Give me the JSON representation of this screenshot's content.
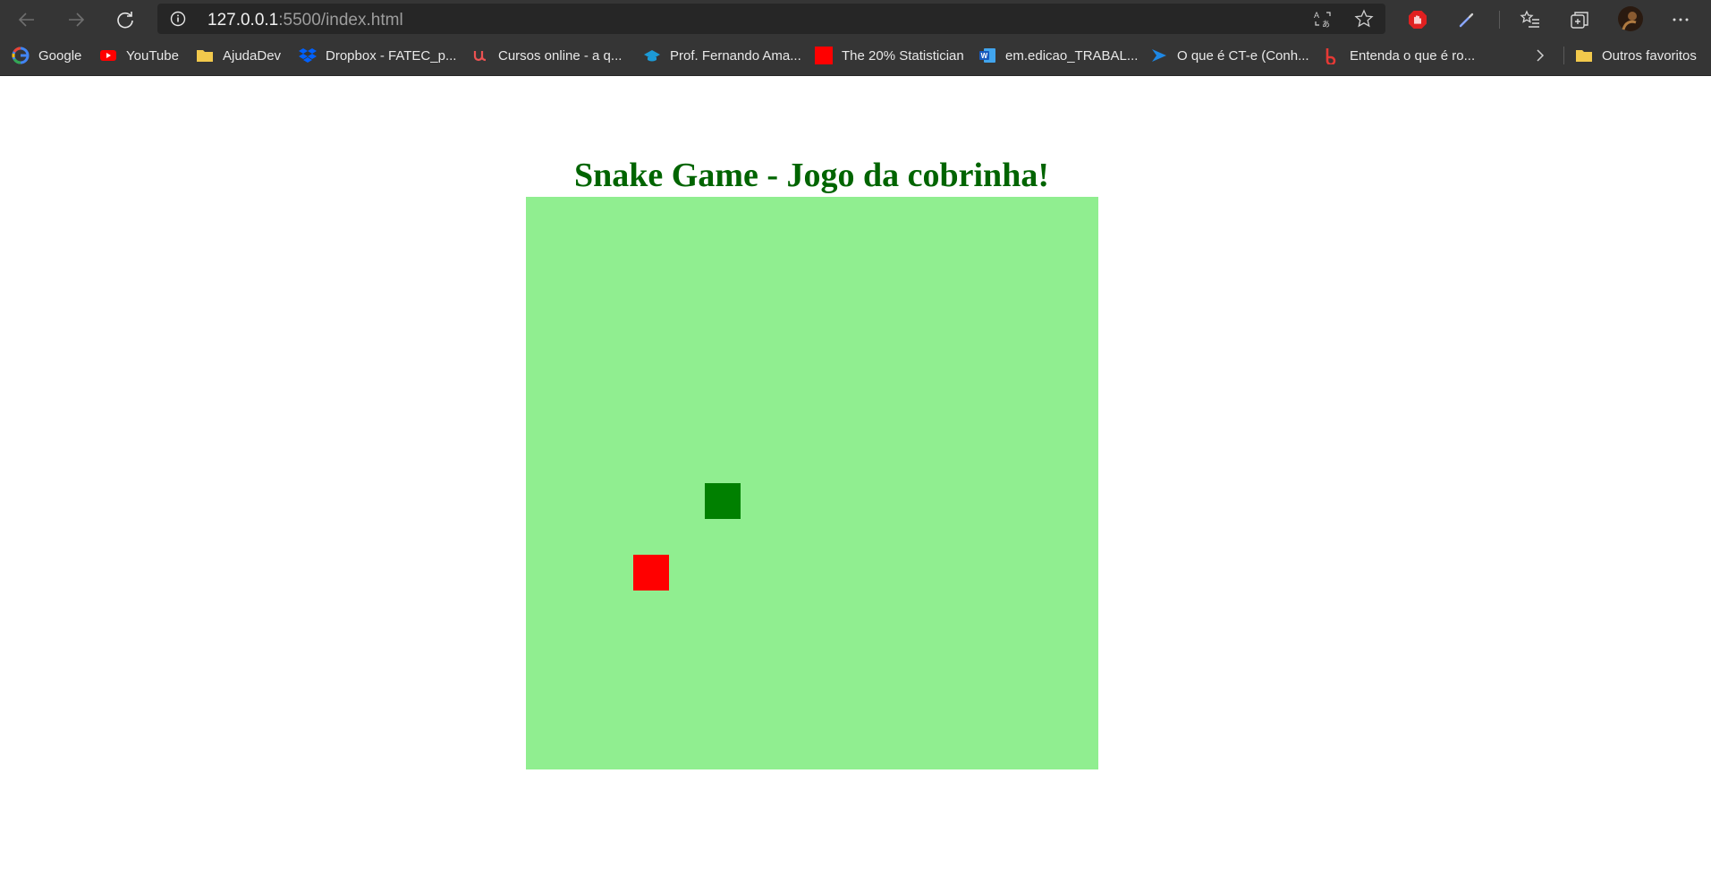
{
  "browser": {
    "url_host": "127.0.0.1",
    "url_path": ":5500/index.html",
    "bookmarks": [
      {
        "label": "Google",
        "icon": "google-icon"
      },
      {
        "label": "YouTube",
        "icon": "youtube-icon"
      },
      {
        "label": "AjudaDev",
        "icon": "folder-icon"
      },
      {
        "label": "Dropbox - FATEC_p...",
        "icon": "dropbox-icon"
      },
      {
        "label": "Cursos online - a q...",
        "icon": "udemy-icon"
      },
      {
        "label": "Prof. Fernando Ama...",
        "icon": "graduation-cap-icon"
      },
      {
        "label": "The 20% Statistician",
        "icon": "red-square-icon"
      },
      {
        "label": "em.edicao_TRABAL...",
        "icon": "word-icon"
      },
      {
        "label": "O que é CT-e (Conh...",
        "icon": "arrow-logo-icon"
      },
      {
        "label": "Entenda o que é ro...",
        "icon": "b-logo-icon"
      }
    ],
    "other_favorites": "Outros favoritos"
  },
  "page": {
    "title": "Snake Game - Jogo da cobrinha!",
    "colors": {
      "title": "#006400",
      "board": "#90ee90",
      "snake": "#008000",
      "food": "#ff0000"
    }
  },
  "game": {
    "grid_cols": 16,
    "grid_rows": 16,
    "snake": [
      {
        "col": 5,
        "row": 8
      }
    ],
    "food": {
      "col": 3,
      "row": 10
    }
  }
}
